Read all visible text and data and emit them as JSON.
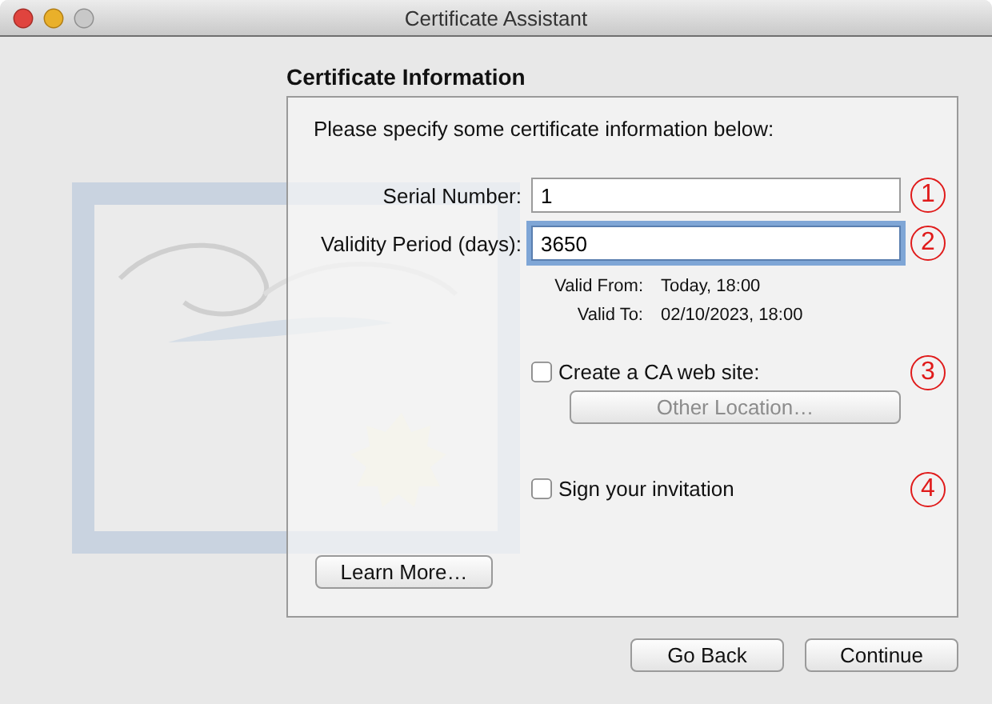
{
  "window": {
    "title": "Certificate Assistant"
  },
  "heading": "Certificate Information",
  "instructions": "Please specify some certificate information below:",
  "fields": [
    {
      "label": "Serial Number:",
      "value": "1",
      "focused": false,
      "marker": "1"
    },
    {
      "label": "Validity Period (days):",
      "value": "3650",
      "focused": true,
      "marker": "2"
    }
  ],
  "validity": [
    {
      "label": "Valid From:",
      "value": "Today, 18:00"
    },
    {
      "label": "Valid To:",
      "value": "02/10/2023, 18:00"
    }
  ],
  "options": [
    {
      "label": "Create a CA web site:",
      "checked": false,
      "marker": "3",
      "button": {
        "label": "Other Location…",
        "disabled": true
      }
    },
    {
      "label": "Sign your invitation",
      "checked": false,
      "marker": "4"
    }
  ],
  "learn_more": "Learn More…",
  "buttons": [
    "Go Back",
    "Continue"
  ]
}
